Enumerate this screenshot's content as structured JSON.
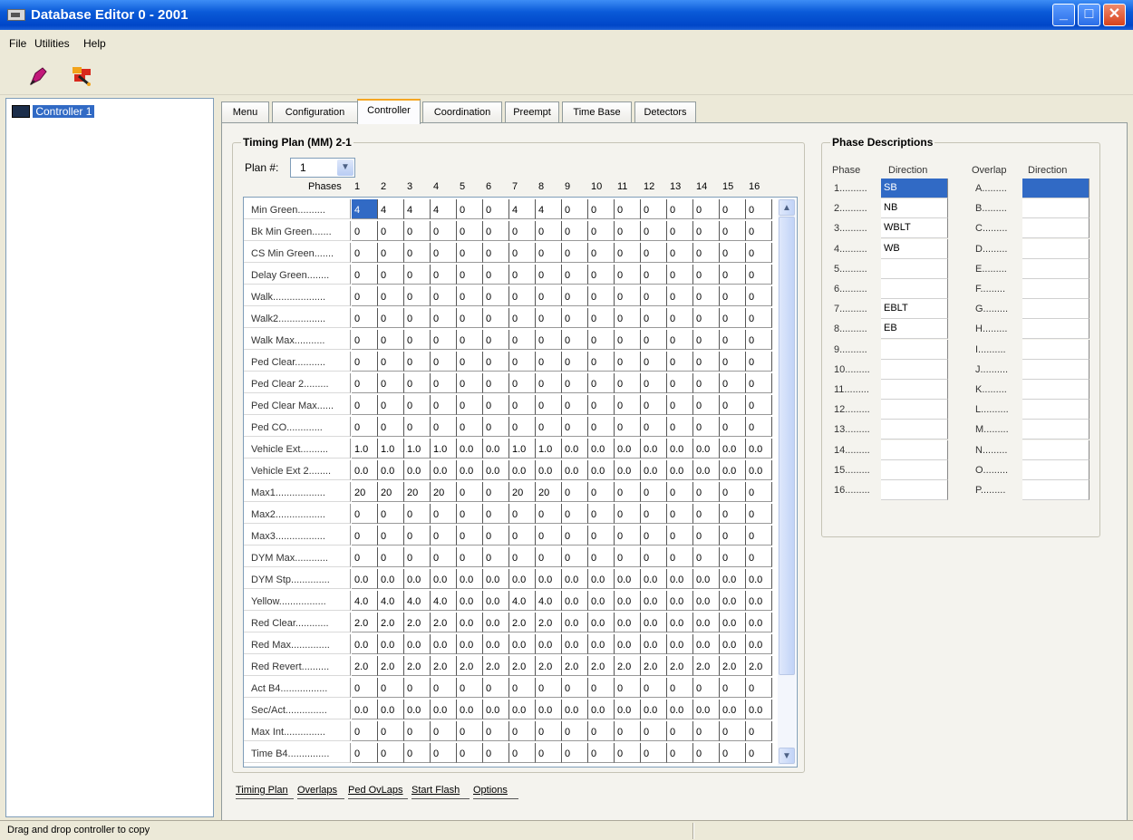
{
  "window": {
    "title": "Database Editor  0 - 2001",
    "min": "_",
    "max": "□",
    "close": "✕"
  },
  "menu": [
    "File",
    "Utilities",
    "Help"
  ],
  "tree": {
    "item": "Controller 1"
  },
  "tabs": [
    "Menu",
    "Configuration",
    "Controller",
    "Coordination",
    "Preempt",
    "Time Base",
    "Detectors"
  ],
  "active_tab": 2,
  "timing": {
    "group_title": "Timing Plan (MM) 2-1",
    "plan_label": "Plan #:",
    "plan_value": "1",
    "phases_label": "Phases",
    "phase_numbers": [
      "1",
      "2",
      "3",
      "4",
      "5",
      "6",
      "7",
      "8",
      "9",
      "10",
      "11",
      "12",
      "13",
      "14",
      "15",
      "16"
    ],
    "rows": [
      {
        "label": "Min Green..........",
        "values": [
          "4",
          "4",
          "4",
          "4",
          "0",
          "0",
          "4",
          "4",
          "0",
          "0",
          "0",
          "0",
          "0",
          "0",
          "0",
          "0"
        ]
      },
      {
        "label": "Bk Min Green.......",
        "values": [
          "0",
          "0",
          "0",
          "0",
          "0",
          "0",
          "0",
          "0",
          "0",
          "0",
          "0",
          "0",
          "0",
          "0",
          "0",
          "0"
        ]
      },
      {
        "label": "CS Min Green.......",
        "values": [
          "0",
          "0",
          "0",
          "0",
          "0",
          "0",
          "0",
          "0",
          "0",
          "0",
          "0",
          "0",
          "0",
          "0",
          "0",
          "0"
        ]
      },
      {
        "label": "Delay Green........",
        "values": [
          "0",
          "0",
          "0",
          "0",
          "0",
          "0",
          "0",
          "0",
          "0",
          "0",
          "0",
          "0",
          "0",
          "0",
          "0",
          "0"
        ]
      },
      {
        "label": "Walk...................",
        "values": [
          "0",
          "0",
          "0",
          "0",
          "0",
          "0",
          "0",
          "0",
          "0",
          "0",
          "0",
          "0",
          "0",
          "0",
          "0",
          "0"
        ]
      },
      {
        "label": "Walk2.................",
        "values": [
          "0",
          "0",
          "0",
          "0",
          "0",
          "0",
          "0",
          "0",
          "0",
          "0",
          "0",
          "0",
          "0",
          "0",
          "0",
          "0"
        ]
      },
      {
        "label": "Walk Max...........",
        "values": [
          "0",
          "0",
          "0",
          "0",
          "0",
          "0",
          "0",
          "0",
          "0",
          "0",
          "0",
          "0",
          "0",
          "0",
          "0",
          "0"
        ]
      },
      {
        "label": "Ped Clear...........",
        "values": [
          "0",
          "0",
          "0",
          "0",
          "0",
          "0",
          "0",
          "0",
          "0",
          "0",
          "0",
          "0",
          "0",
          "0",
          "0",
          "0"
        ]
      },
      {
        "label": "Ped Clear 2.........",
        "values": [
          "0",
          "0",
          "0",
          "0",
          "0",
          "0",
          "0",
          "0",
          "0",
          "0",
          "0",
          "0",
          "0",
          "0",
          "0",
          "0"
        ]
      },
      {
        "label": "Ped Clear Max......",
        "values": [
          "0",
          "0",
          "0",
          "0",
          "0",
          "0",
          "0",
          "0",
          "0",
          "0",
          "0",
          "0",
          "0",
          "0",
          "0",
          "0"
        ]
      },
      {
        "label": "Ped CO.............",
        "values": [
          "0",
          "0",
          "0",
          "0",
          "0",
          "0",
          "0",
          "0",
          "0",
          "0",
          "0",
          "0",
          "0",
          "0",
          "0",
          "0"
        ]
      },
      {
        "label": "Vehicle Ext..........",
        "values": [
          "1.0",
          "1.0",
          "1.0",
          "1.0",
          "0.0",
          "0.0",
          "1.0",
          "1.0",
          "0.0",
          "0.0",
          "0.0",
          "0.0",
          "0.0",
          "0.0",
          "0.0",
          "0.0"
        ]
      },
      {
        "label": "Vehicle Ext 2........",
        "values": [
          "0.0",
          "0.0",
          "0.0",
          "0.0",
          "0.0",
          "0.0",
          "0.0",
          "0.0",
          "0.0",
          "0.0",
          "0.0",
          "0.0",
          "0.0",
          "0.0",
          "0.0",
          "0.0"
        ]
      },
      {
        "label": "Max1..................",
        "values": [
          "20",
          "20",
          "20",
          "20",
          "0",
          "0",
          "20",
          "20",
          "0",
          "0",
          "0",
          "0",
          "0",
          "0",
          "0",
          "0"
        ]
      },
      {
        "label": "Max2..................",
        "values": [
          "0",
          "0",
          "0",
          "0",
          "0",
          "0",
          "0",
          "0",
          "0",
          "0",
          "0",
          "0",
          "0",
          "0",
          "0",
          "0"
        ]
      },
      {
        "label": "Max3..................",
        "values": [
          "0",
          "0",
          "0",
          "0",
          "0",
          "0",
          "0",
          "0",
          "0",
          "0",
          "0",
          "0",
          "0",
          "0",
          "0",
          "0"
        ]
      },
      {
        "label": "DYM Max............",
        "values": [
          "0",
          "0",
          "0",
          "0",
          "0",
          "0",
          "0",
          "0",
          "0",
          "0",
          "0",
          "0",
          "0",
          "0",
          "0",
          "0"
        ]
      },
      {
        "label": "DYM Stp..............",
        "values": [
          "0.0",
          "0.0",
          "0.0",
          "0.0",
          "0.0",
          "0.0",
          "0.0",
          "0.0",
          "0.0",
          "0.0",
          "0.0",
          "0.0",
          "0.0",
          "0.0",
          "0.0",
          "0.0"
        ]
      },
      {
        "label": "Yellow.................",
        "values": [
          "4.0",
          "4.0",
          "4.0",
          "4.0",
          "0.0",
          "0.0",
          "4.0",
          "4.0",
          "0.0",
          "0.0",
          "0.0",
          "0.0",
          "0.0",
          "0.0",
          "0.0",
          "0.0"
        ]
      },
      {
        "label": "Red Clear............",
        "values": [
          "2.0",
          "2.0",
          "2.0",
          "2.0",
          "0.0",
          "0.0",
          "2.0",
          "2.0",
          "0.0",
          "0.0",
          "0.0",
          "0.0",
          "0.0",
          "0.0",
          "0.0",
          "0.0"
        ]
      },
      {
        "label": "Red Max..............",
        "values": [
          "0.0",
          "0.0",
          "0.0",
          "0.0",
          "0.0",
          "0.0",
          "0.0",
          "0.0",
          "0.0",
          "0.0",
          "0.0",
          "0.0",
          "0.0",
          "0.0",
          "0.0",
          "0.0"
        ]
      },
      {
        "label": "Red  Revert..........",
        "values": [
          "2.0",
          "2.0",
          "2.0",
          "2.0",
          "2.0",
          "2.0",
          "2.0",
          "2.0",
          "2.0",
          "2.0",
          "2.0",
          "2.0",
          "2.0",
          "2.0",
          "2.0",
          "2.0"
        ]
      },
      {
        "label": "Act B4.................",
        "values": [
          "0",
          "0",
          "0",
          "0",
          "0",
          "0",
          "0",
          "0",
          "0",
          "0",
          "0",
          "0",
          "0",
          "0",
          "0",
          "0"
        ]
      },
      {
        "label": "Sec/Act...............",
        "values": [
          "0.0",
          "0.0",
          "0.0",
          "0.0",
          "0.0",
          "0.0",
          "0.0",
          "0.0",
          "0.0",
          "0.0",
          "0.0",
          "0.0",
          "0.0",
          "0.0",
          "0.0",
          "0.0"
        ]
      },
      {
        "label": "Max Int...............",
        "values": [
          "0",
          "0",
          "0",
          "0",
          "0",
          "0",
          "0",
          "0",
          "0",
          "0",
          "0",
          "0",
          "0",
          "0",
          "0",
          "0"
        ]
      },
      {
        "label": "Time B4...............",
        "values": [
          "0",
          "0",
          "0",
          "0",
          "0",
          "0",
          "0",
          "0",
          "0",
          "0",
          "0",
          "0",
          "0",
          "0",
          "0",
          "0"
        ]
      }
    ]
  },
  "phase_desc": {
    "group_title": "Phase Descriptions",
    "phase_header": "Phase",
    "direction_header": "Direction",
    "overlap_header": "Overlap",
    "overlap_direction_header": "Direction",
    "phases": [
      {
        "label": "1..........",
        "dir": "SB"
      },
      {
        "label": "2..........",
        "dir": "NB"
      },
      {
        "label": "3..........",
        "dir": "WBLT"
      },
      {
        "label": "4..........",
        "dir": "WB"
      },
      {
        "label": "5..........",
        "dir": ""
      },
      {
        "label": "6..........",
        "dir": ""
      },
      {
        "label": "7..........",
        "dir": "EBLT"
      },
      {
        "label": "8..........",
        "dir": "EB"
      },
      {
        "label": "9..........",
        "dir": ""
      },
      {
        "label": "10.........",
        "dir": ""
      },
      {
        "label": "11.........",
        "dir": ""
      },
      {
        "label": "12.........",
        "dir": ""
      },
      {
        "label": "13.........",
        "dir": ""
      },
      {
        "label": "14.........",
        "dir": ""
      },
      {
        "label": "15.........",
        "dir": ""
      },
      {
        "label": "16.........",
        "dir": ""
      }
    ],
    "overlaps": [
      {
        "label": "A.........",
        "dir": ""
      },
      {
        "label": "B.........",
        "dir": ""
      },
      {
        "label": "C.........",
        "dir": ""
      },
      {
        "label": "D.........",
        "dir": ""
      },
      {
        "label": "E.........",
        "dir": ""
      },
      {
        "label": "F.........",
        "dir": ""
      },
      {
        "label": "G.........",
        "dir": ""
      },
      {
        "label": "H.........",
        "dir": ""
      },
      {
        "label": "I..........",
        "dir": ""
      },
      {
        "label": "J..........",
        "dir": ""
      },
      {
        "label": "K.........",
        "dir": ""
      },
      {
        "label": "L..........",
        "dir": ""
      },
      {
        "label": "M.........",
        "dir": ""
      },
      {
        "label": "N.........",
        "dir": ""
      },
      {
        "label": "O.........",
        "dir": ""
      },
      {
        "label": "P.........",
        "dir": ""
      }
    ]
  },
  "bottom_tabs": [
    "Timing Plan",
    "Overlaps",
    "Ped OvLaps",
    "Start Flash",
    "Options"
  ],
  "status": {
    "text": "Drag and drop controller to copy"
  },
  "colors": {
    "selection": "#316ac5",
    "title_bar": "#0a5ad8",
    "active_tab_accent": "#f5a623"
  }
}
